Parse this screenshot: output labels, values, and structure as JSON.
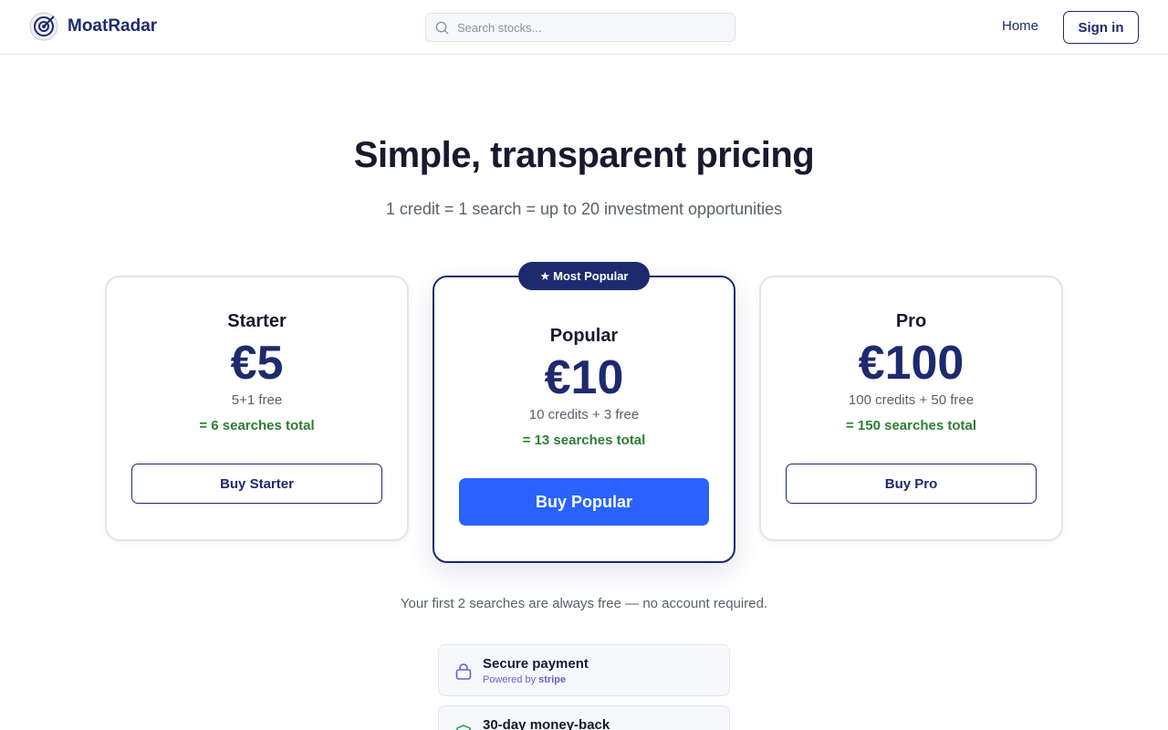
{
  "brand": {
    "name": "MoatRadar"
  },
  "search": {
    "placeholder": "Search stocks..."
  },
  "nav": {
    "home": "Home",
    "signin": "Sign in"
  },
  "hero": {
    "title": "Simple, transparent pricing",
    "subtitle": "1 credit = 1 search = up to 20 investment opportunities"
  },
  "plans": [
    {
      "name": "Starter",
      "price": "€5",
      "credits": "5+1 free",
      "total": "= 6 searches total",
      "button": "Buy Starter"
    },
    {
      "name": "Popular",
      "price": "€10",
      "credits": "10 credits + 3 free",
      "total": "= 13 searches total",
      "button": "Buy Popular",
      "badge": "Most Popular"
    },
    {
      "name": "Pro",
      "price": "€100",
      "credits": "100 credits + 50 free",
      "total": "= 150 searches total",
      "button": "Buy Pro"
    }
  ],
  "free_note": "Your first 2 searches are always free — no account required.",
  "trust": [
    {
      "title": "Secure payment",
      "sub_prefix": "Powered by",
      "sub_brand": "stripe",
      "icon": "lock-icon"
    },
    {
      "title": "30-day money-back",
      "icon": "shield-check-icon"
    }
  ],
  "colors": {
    "primary": "#1e2a6e",
    "accent": "#2962ff",
    "success": "#2e7d32",
    "stripe": "#6b5bd6"
  }
}
